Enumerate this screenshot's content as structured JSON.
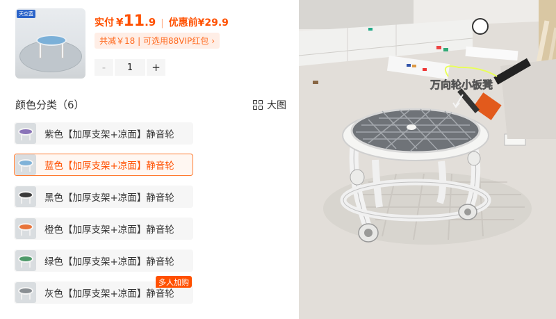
{
  "product": {
    "thumb_badge": "天空蓝",
    "price": {
      "label": "实付",
      "yen": "¥",
      "integer": "11",
      "decimal": ".9",
      "separator": "|",
      "original": "优惠前¥29.9"
    },
    "promo": {
      "text": "共减￥18 | 可选用88VIP红包",
      "chevron": "›"
    },
    "quantity": {
      "minus": "-",
      "value": "1",
      "plus": "+"
    }
  },
  "variants": {
    "title": "颜色分类（6）",
    "view_label": "大图",
    "selected_index": 1,
    "items": [
      {
        "label": "紫色【加厚支架+凉面】静音轮",
        "swatch": "#8a74b8"
      },
      {
        "label": "蓝色【加厚支架+凉面】静音轮",
        "swatch": "#7fb2d8"
      },
      {
        "label": "黑色【加厚支架+凉面】静音轮",
        "swatch": "#3a3a3a"
      },
      {
        "label": "橙色【加厚支架+凉面】静音轮",
        "swatch": "#e8743a"
      },
      {
        "label": "绿色【加厚支架+凉面】静音轮",
        "swatch": "#4e9a6a"
      },
      {
        "label": "灰色【加厚支架+凉面】静音轮",
        "swatch": "#8a8f93"
      }
    ],
    "hot_tag": "多人加购"
  },
  "photo": {
    "caption": "万向轮小板凳",
    "accent": "#ff5000"
  }
}
